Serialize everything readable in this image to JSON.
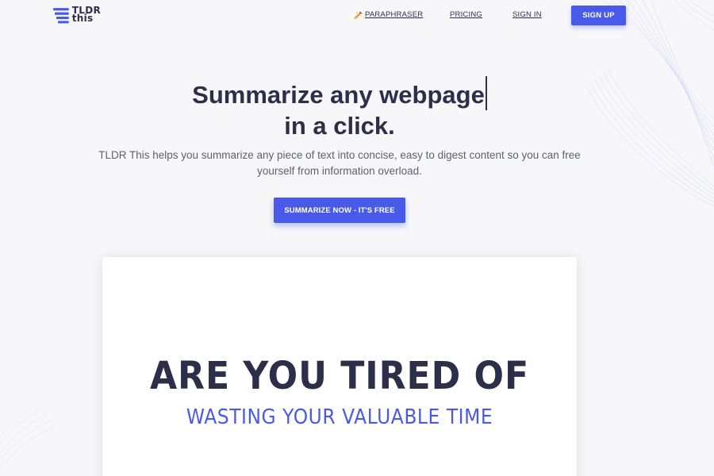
{
  "brand": {
    "logo_line1": "TLDR",
    "logo_line2": "this"
  },
  "nav": {
    "paraphraser": "PARAPHRASER",
    "pricing": "PRICING",
    "sign_in": "SIGN IN",
    "sign_up": "SIGN UP"
  },
  "hero": {
    "title_line1": "Summarize any webpage",
    "title_line2": "in a click.",
    "subtitle": "TLDR This helps you summarize any piece of text into concise, easy to digest content so you can free yourself from information overload.",
    "cta": "SUMMARIZE NOW - IT'S FREE"
  },
  "video_card": {
    "headline": "ARE YOU TIRED OF",
    "subheadline": "WASTING YOUR VALUABLE TIME"
  },
  "icons": {
    "logo": "stacked-lines-logo-icon",
    "paraphraser": "magic-wand-icon"
  },
  "colors": {
    "accent": "#4a5ae8",
    "text_dark": "#2c2f4a",
    "text_muted": "#5c6073",
    "background": "#f7f7fa"
  }
}
